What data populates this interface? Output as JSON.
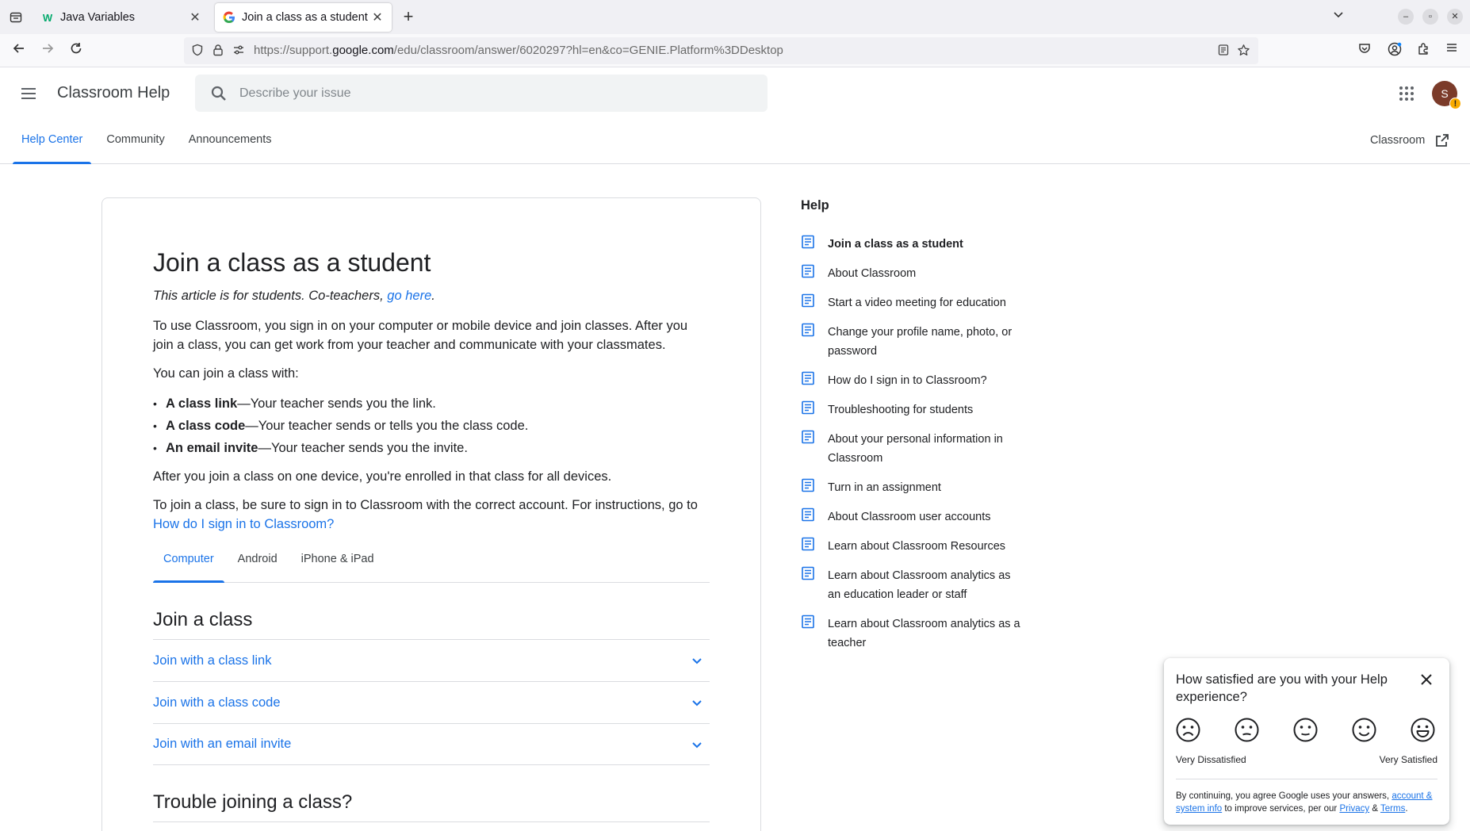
{
  "browser": {
    "tabs": [
      {
        "title": "Java Variables",
        "favicon": "W",
        "active": false
      },
      {
        "title": "Join a class as a student -",
        "favicon": "G",
        "active": true
      }
    ],
    "url_prefix": "https://support.",
    "url_domain": "google.com",
    "url_path": "/edu/classroom/answer/6020297?hl=en&co=GENIE.Platform%3DDesktop"
  },
  "header": {
    "product_name": "Classroom Help",
    "search_placeholder": "Describe your issue",
    "avatar_initial": "S",
    "avatar_badge": "!",
    "tabs": [
      "Help Center",
      "Community",
      "Announcements"
    ],
    "product_link": "Classroom"
  },
  "article": {
    "title": "Join a class as a student",
    "intro_text": "This article is for students. Co-teachers, ",
    "intro_link": "go here",
    "intro_end": ".",
    "p1": "To use Classroom, you sign in on your computer or mobile device and join classes. After you join a class, you can get work from your teacher and communicate with your classmates.",
    "p2": "You can join a class with:",
    "bullets": [
      {
        "bold": "A class link",
        "rest": "—Your teacher sends you the link."
      },
      {
        "bold": "A class code",
        "rest": "—Your teacher sends or tells you the class code."
      },
      {
        "bold": "An email invite",
        "rest": "—Your teacher sends you the invite."
      }
    ],
    "p3": "After you join a class on one device, you're enrolled in that class for all devices.",
    "p4": "To join a class, be sure to sign in to Classroom with the correct account. For instructions, go to ",
    "p4_link": "How do I sign in to Classroom?",
    "platform_tabs": [
      "Computer",
      "Android",
      "iPhone & iPad"
    ],
    "section1": "Join a class",
    "accordion": [
      "Join with a class link",
      "Join with a class code",
      "Join with an email invite"
    ],
    "section2": "Trouble joining a class?"
  },
  "sidebar": {
    "title": "Help",
    "items": [
      "Join a class as a student",
      "About Classroom",
      "Start a video meeting for education",
      "Change your profile name, photo, or password",
      "How do I sign in to Classroom?",
      "Troubleshooting for students",
      "About your personal information in Classroom",
      "Turn in an assignment",
      "About Classroom user accounts",
      "Learn about Classroom Resources",
      "Learn about Classroom analytics as an education leader or staff",
      "Learn about Classroom analytics as a teacher"
    ]
  },
  "survey": {
    "question": "How satisfied are you with your Help experience?",
    "label_low": "Very Dissatisfied",
    "label_high": "Very Satisfied",
    "legal_1": "By continuing, you agree Google uses your answers, ",
    "legal_link1": "account & system info",
    "legal_2": " to improve services, per our ",
    "legal_link2": "Privacy",
    "legal_3": " & ",
    "legal_link3": "Terms",
    "legal_4": "."
  }
}
